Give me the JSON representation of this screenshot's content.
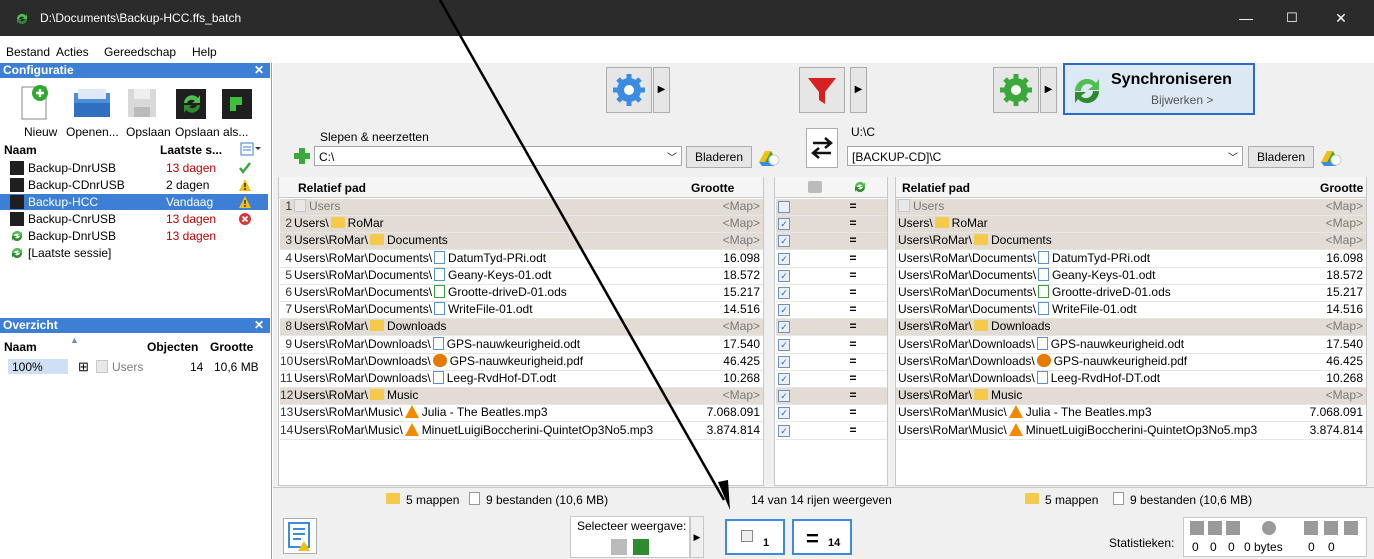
{
  "window": {
    "title": "D:\\Documents\\Backup-HCC.ffs_batch",
    "minimize": "—",
    "maximize": "☐",
    "close": "✕"
  },
  "menu": [
    "Bestand",
    "Acties",
    "Gereedschap",
    "Help"
  ],
  "config_panel": {
    "title": "Configuratie",
    "close": "✕",
    "buttons": [
      "Nieuw",
      "Openen...",
      "Opslaan",
      "Opslaan als..."
    ],
    "col_name": "Naam",
    "col_last": "Laatste s...",
    "rows": [
      {
        "name": "Backup-DnrUSB",
        "age": "13 dagen",
        "status": "ok"
      },
      {
        "name": "Backup-CDnrUSB",
        "age": "2 dagen",
        "status": "warn"
      },
      {
        "name": "Backup-HCC",
        "age": "Vandaag",
        "status": "warn"
      },
      {
        "name": "Backup-CnrUSB",
        "age": "13 dagen",
        "status": "error"
      },
      {
        "name": "Backup-DnrUSB",
        "age": "13 dagen",
        "status": ""
      },
      {
        "name": "[Laatste sessie]",
        "age": "",
        "status": ""
      }
    ]
  },
  "overview_panel": {
    "title": "Overzicht",
    "close": "✕",
    "col_name": "Naam",
    "col_objects": "Objecten",
    "col_size": "Grootte",
    "row": {
      "pct": "100%",
      "expander": "⊞",
      "name": "Users",
      "objects": "14",
      "size": "10,6 MB"
    }
  },
  "sync": {
    "label": "Synchroniseren",
    "sub": "Bijwerken >"
  },
  "left_folder": {
    "drag_label": "Slepen & neerzetten",
    "path": "C:\\",
    "browse": "Bladeren"
  },
  "right_folder": {
    "drag_label": "U:\\C",
    "path": "[BACKUP-CD]\\C",
    "browse": "Bladeren"
  },
  "grid_headers": {
    "path": "Relatief pad",
    "size": "Grootte"
  },
  "rows": [
    {
      "n": "1",
      "prefix": "",
      "icon": "user",
      "name": "Users",
      "size": "<Map>",
      "folder": true,
      "grey": true,
      "checked": false
    },
    {
      "n": "2",
      "prefix": "Users\\",
      "icon": "folder",
      "name": "RoMar",
      "size": "<Map>",
      "folder": true,
      "grey": false,
      "checked": true
    },
    {
      "n": "3",
      "prefix": "Users\\RoMar\\",
      "icon": "folder",
      "name": "Documents",
      "size": "<Map>",
      "folder": true,
      "grey": false,
      "checked": true
    },
    {
      "n": "4",
      "prefix": "Users\\RoMar\\Documents\\",
      "icon": "doc",
      "name": "DatumTyd-PRi.odt",
      "size": "16.098",
      "folder": false,
      "grey": false,
      "checked": true
    },
    {
      "n": "5",
      "prefix": "Users\\RoMar\\Documents\\",
      "icon": "doc",
      "name": "Geany-Keys-01.odt",
      "size": "18.572",
      "folder": false,
      "grey": false,
      "checked": true
    },
    {
      "n": "6",
      "prefix": "Users\\RoMar\\Documents\\",
      "icon": "ods",
      "name": "Grootte-driveD-01.ods",
      "size": "15.217",
      "folder": false,
      "grey": false,
      "checked": true
    },
    {
      "n": "7",
      "prefix": "Users\\RoMar\\Documents\\",
      "icon": "doc",
      "name": "WriteFile-01.odt",
      "size": "14.516",
      "folder": false,
      "grey": false,
      "checked": true
    },
    {
      "n": "8",
      "prefix": "Users\\RoMar\\",
      "icon": "folder",
      "name": "Downloads",
      "size": "<Map>",
      "folder": true,
      "grey": false,
      "checked": true
    },
    {
      "n": "9",
      "prefix": "Users\\RoMar\\Downloads\\",
      "icon": "doc",
      "name": "GPS-nauwkeurigheid.odt",
      "size": "17.540",
      "folder": false,
      "grey": false,
      "checked": true
    },
    {
      "n": "10",
      "prefix": "Users\\RoMar\\Downloads\\",
      "icon": "pdf",
      "name": "GPS-nauwkeurigheid.pdf",
      "size": "46.425",
      "folder": false,
      "grey": false,
      "checked": true
    },
    {
      "n": "11",
      "prefix": "Users\\RoMar\\Downloads\\",
      "icon": "doc",
      "name": "Leeg-RvdHof-DT.odt",
      "size": "10.268",
      "folder": false,
      "grey": false,
      "checked": true
    },
    {
      "n": "12",
      "prefix": "Users\\RoMar\\",
      "icon": "folder",
      "name": "Music",
      "size": "<Map>",
      "folder": true,
      "grey": false,
      "checked": true
    },
    {
      "n": "13",
      "prefix": "Users\\RoMar\\Music\\",
      "icon": "cone",
      "name": "Julia - The Beatles.mp3",
      "size": "7.068.091",
      "folder": false,
      "grey": false,
      "checked": true
    },
    {
      "n": "14",
      "prefix": "Users\\RoMar\\Music\\",
      "icon": "cone",
      "name": "MinuetLuigiBoccherini-QuintetOp3No5.mp3",
      "size": "3.874.814",
      "folder": false,
      "grey": false,
      "checked": true
    }
  ],
  "status": {
    "left_folders": "5 mappen",
    "left_files": "9 bestanden (10,6 MB)",
    "center": "14 van 14 rijen weergeven",
    "right_folders": "5 mappen",
    "right_files": "9 bestanden (10,6 MB)"
  },
  "bottom": {
    "select_view": "Selecteer weergave:",
    "filter1_count": "1",
    "filter2_count": "14",
    "stats_label": "Statistieken:",
    "stats": [
      "0",
      "0",
      "0",
      "0 bytes",
      "0",
      "0"
    ]
  },
  "colors": {
    "accent": "#3d7fd4",
    "error": "#c00000",
    "selected": "#3d7fd4"
  }
}
